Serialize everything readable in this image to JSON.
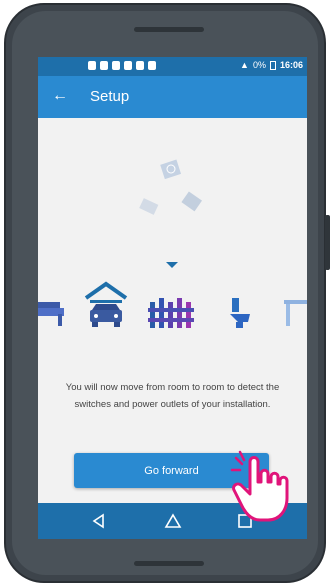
{
  "status_bar": {
    "battery": "0%",
    "time": "16:06"
  },
  "app_bar": {
    "title": "Setup"
  },
  "instructions": "You will now move from room to room to detect the switches and power outlets of your installation.",
  "primary_button": {
    "label": "Go forward"
  },
  "navigation": [
    "back",
    "home",
    "recents"
  ],
  "colors": {
    "primary": "#2a8ad1",
    "status": "#1e6faa",
    "screen_bg": "#f2f2f2",
    "accent_pink": "#e0147a"
  }
}
